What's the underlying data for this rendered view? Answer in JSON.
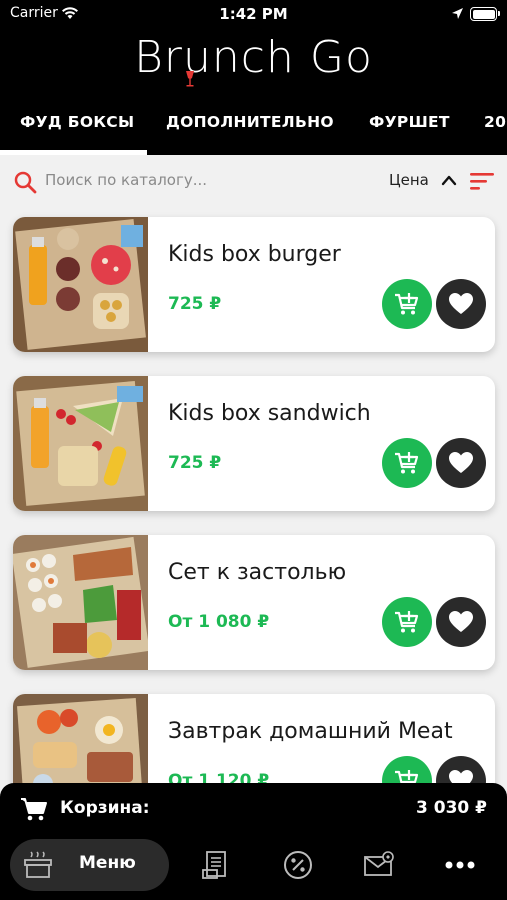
{
  "status_bar": {
    "carrier": "Carrier",
    "time": "1:42 PM"
  },
  "header": {
    "logo_text": "Brunch Go"
  },
  "tabs": [
    {
      "label": "ФУД БОКСЫ",
      "active": true
    },
    {
      "label": "ДОПОЛНИТЕЛЬНО",
      "active": false
    },
    {
      "label": "ФУРШЕТ",
      "active": false
    },
    {
      "label": "20",
      "active": false
    }
  ],
  "search": {
    "placeholder": "Поиск по каталогу...",
    "value": ""
  },
  "sort": {
    "label": "Цена",
    "direction": "ascending"
  },
  "products": [
    {
      "title": "Kids box burger",
      "price": "725 ₽"
    },
    {
      "title": "Kids box sandwich",
      "price": "725 ₽"
    },
    {
      "title": "Сет к застолью",
      "price": "От 1 080 ₽"
    },
    {
      "title": "Завтрак домашний Meat",
      "price": "От 1 120 ₽"
    }
  ],
  "cart": {
    "label": "Корзина:",
    "total": "3 030 ₽"
  },
  "bottom_nav": [
    {
      "label": "Меню",
      "icon": "food-box-icon",
      "active": true
    },
    {
      "label": "",
      "icon": "orders-receipt-icon",
      "active": false
    },
    {
      "label": "",
      "icon": "discount-icon",
      "active": false
    },
    {
      "label": "",
      "icon": "mail-icon",
      "active": false
    },
    {
      "label": "",
      "icon": "more-icon",
      "active": false
    }
  ],
  "colors": {
    "accent_green": "#1db954",
    "accent_red": "#e53935",
    "dark": "#000000"
  }
}
